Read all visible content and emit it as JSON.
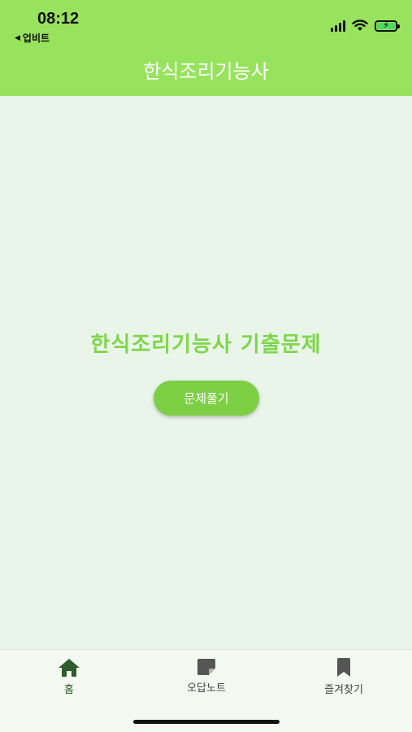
{
  "status_bar": {
    "time": "08:12",
    "back_app": "업비트",
    "back_icon": "back-triangle-icon"
  },
  "header": {
    "title": "한식조리기능사"
  },
  "main": {
    "heading": "한식조리기능사 기출문제",
    "start_button_label": "문제풀기"
  },
  "tabbar": {
    "tabs": [
      {
        "label": "홈",
        "icon": "home-icon",
        "active": true
      },
      {
        "label": "오답노트",
        "icon": "note-icon",
        "active": false
      },
      {
        "label": "즐겨찾기",
        "icon": "bookmark-icon",
        "active": false
      }
    ]
  },
  "colors": {
    "header_bg": "#97e35e",
    "accent": "#7dcf44",
    "heading": "#7fd64a",
    "active_tab": "#2e5c2a",
    "inactive_tab": "#555555"
  }
}
